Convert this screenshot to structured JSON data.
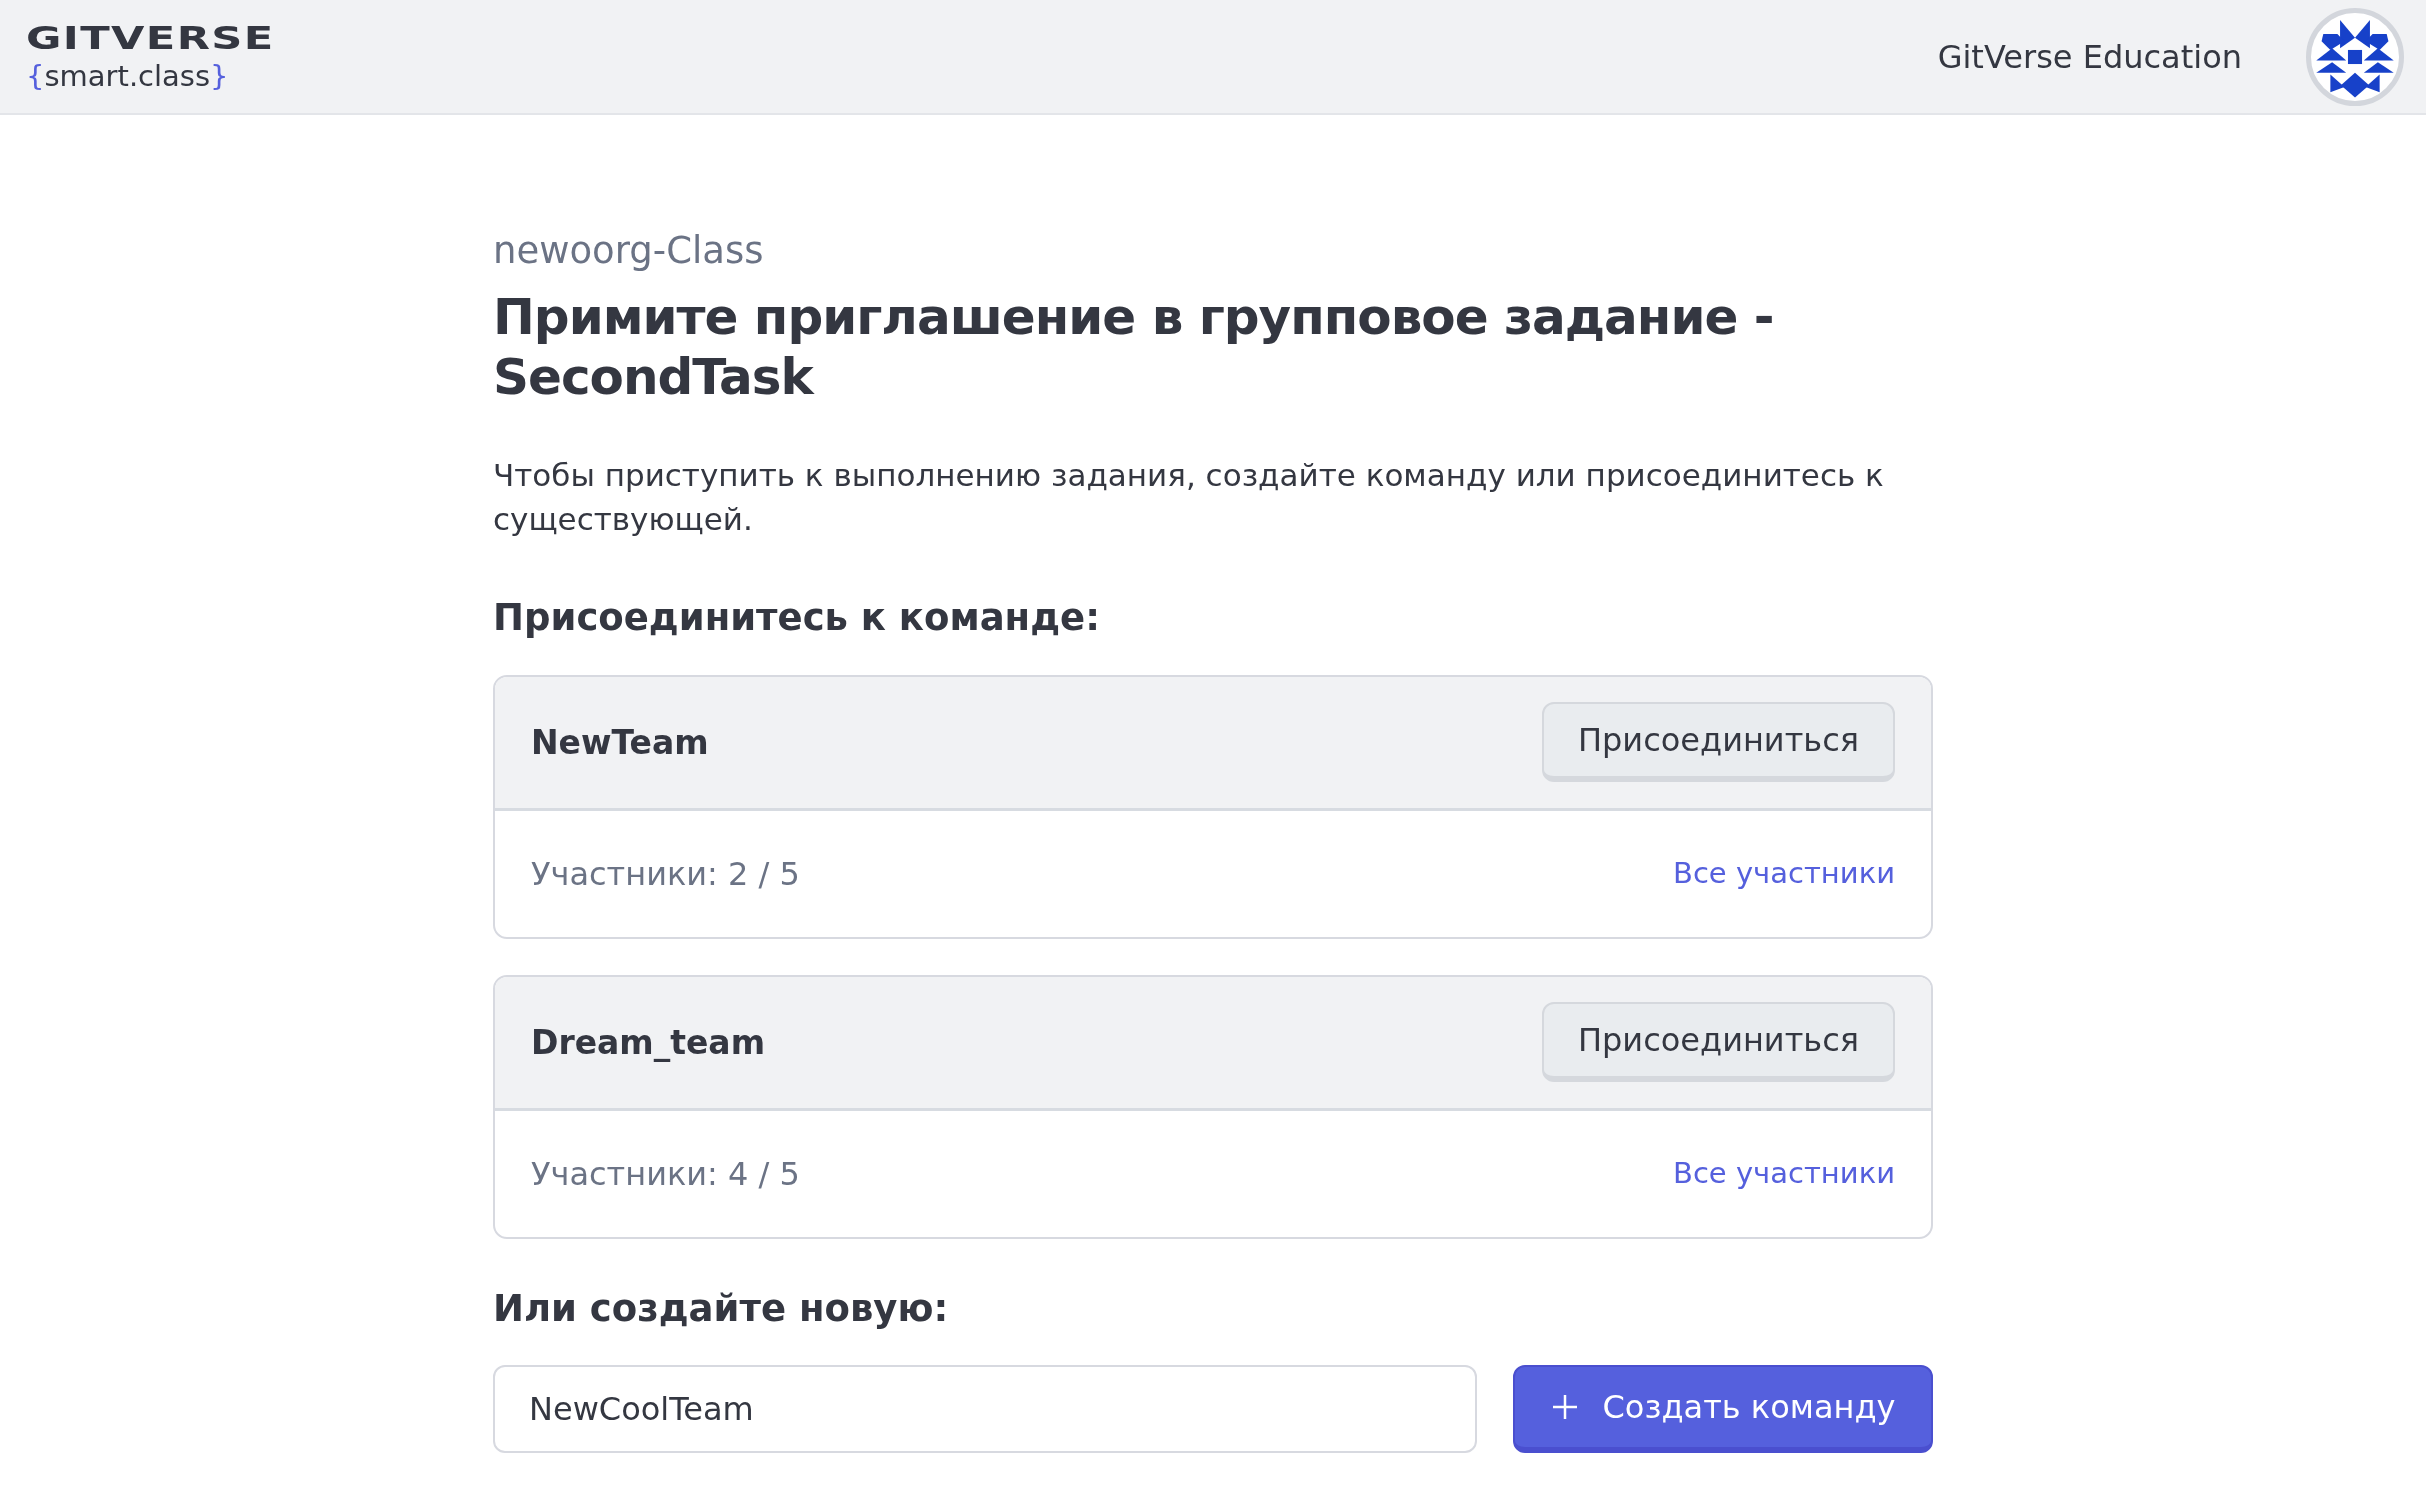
{
  "header": {
    "logo_word": "GITVERSE",
    "logo_sub": "smart.class",
    "logo_brace_open": "{",
    "logo_brace_close": "}",
    "org_name": "GitVerse Education"
  },
  "page": {
    "org": "newoorg-Class",
    "title": "Примите приглашение в групповое задание - SecondTask",
    "intro": "Чтобы приступить к выполнению задания, создайте команду или присоединитесь к существующей.",
    "join_heading": "Присоединитесь к команде:"
  },
  "teams": [
    {
      "name": "NewTeam",
      "join_button": "Присоединиться",
      "members": "Участники: 2 / 5",
      "members_link": "Все участники"
    },
    {
      "name": "Dream_team",
      "join_button": "Присоединиться",
      "members": "Участники: 4 / 5",
      "members_link": "Все участники"
    }
  ],
  "create": {
    "heading": "Или создайте новую:",
    "team_name": {
      "value": "NewCoolTeam"
    },
    "button": "Создать команду"
  }
}
